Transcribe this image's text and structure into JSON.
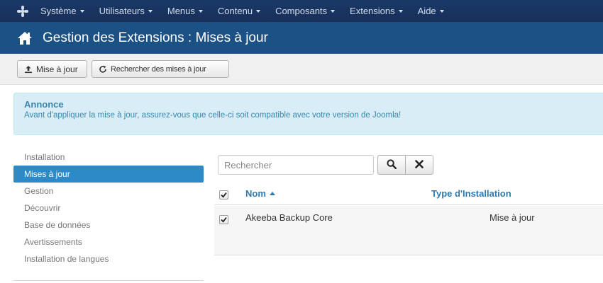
{
  "nav": {
    "logo_icon": "joomla-icon",
    "items": [
      {
        "label": "Système"
      },
      {
        "label": "Utilisateurs"
      },
      {
        "label": "Menus"
      },
      {
        "label": "Contenu"
      },
      {
        "label": "Composants"
      },
      {
        "label": "Extensions"
      },
      {
        "label": "Aide"
      }
    ]
  },
  "header": {
    "icon": "home-icon",
    "title": "Gestion des Extensions : Mises à jour"
  },
  "toolbar": {
    "update_label": "Mise à jour",
    "find_label": "Rechercher des mises à jour"
  },
  "alert": {
    "heading": "Annonce",
    "text": "Avant d'appliquer la mise à jour, assurez-vous que celle-ci soit compatible avec votre version de Joomla!"
  },
  "sidebar": {
    "items": [
      {
        "label": "Installation",
        "active": false
      },
      {
        "label": "Mises à jour",
        "active": true
      },
      {
        "label": "Gestion",
        "active": false
      },
      {
        "label": "Découvrir",
        "active": false
      },
      {
        "label": "Base de données",
        "active": false
      },
      {
        "label": "Avertissements",
        "active": false
      },
      {
        "label": "Installation de langues",
        "active": false
      }
    ]
  },
  "search": {
    "placeholder": "Rechercher",
    "value": ""
  },
  "table": {
    "columns": {
      "name": "Nom",
      "type": "Type d'Installation"
    },
    "rows": [
      {
        "name": "Akeeba Backup Core",
        "type": "Mise à jour",
        "checked": true
      }
    ],
    "select_all_checked": true
  },
  "colors": {
    "nav_bg": "#17305a",
    "header_bg": "#1c5186",
    "sidebar_active": "#2d8ac7",
    "alert_bg": "#d9edf7",
    "link": "#2a7ab0"
  }
}
